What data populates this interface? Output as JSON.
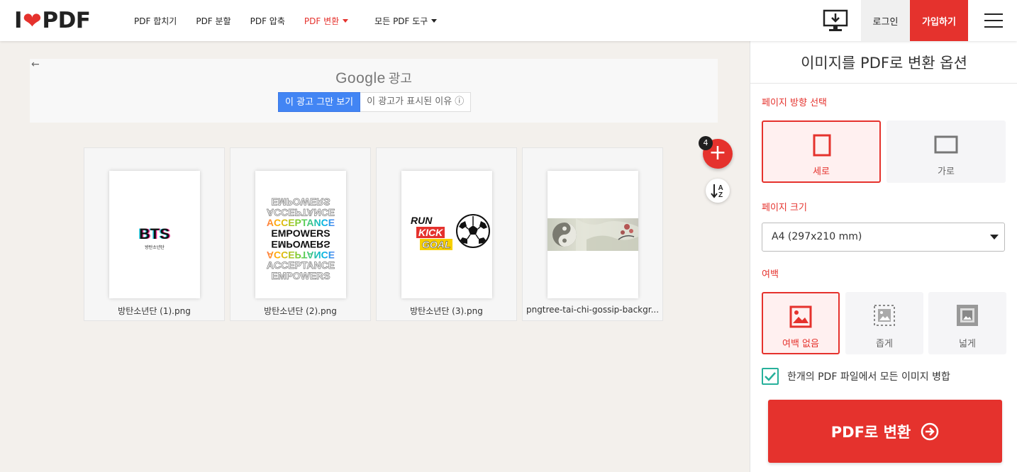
{
  "header": {
    "logo_left": "I",
    "logo_right": "PDF",
    "nav": [
      {
        "label": "PDF 합치기"
      },
      {
        "label": "PDF 분할"
      },
      {
        "label": "PDF 압축"
      },
      {
        "label": "PDF 변환"
      },
      {
        "label": "모든 PDF 도구"
      }
    ],
    "login": "로그인",
    "signup": "가입하기"
  },
  "ad": {
    "back": "←",
    "brand": "Google",
    "brand_suffix": "광고",
    "stop_label": "이 광고 그만 보기",
    "why_label": "이 광고가 표시된 이유 ⓘ"
  },
  "files": [
    {
      "name": "방탄소년단 (1).png",
      "thumb_title": "BTS",
      "thumb_sub": "방탄소년단"
    },
    {
      "name": "방탄소년단 (2).png",
      "thumb_lines": [
        "EMPOWERS",
        "ACCEPTANCE",
        "ACCEPTANCE",
        "EMPOWERS",
        "EMPOWERS",
        "ACCEPTANCE",
        "ACCEPTANCE",
        "EMPOWERS"
      ]
    },
    {
      "name": "방탄소년단 (3).png",
      "thumb_lines": [
        "RUN",
        "KICK",
        "GOAL"
      ]
    },
    {
      "name": "pngtree-tai-chi-gossip-backgr..."
    }
  ],
  "file_count": "4",
  "sort_label": "A Z",
  "panel": {
    "title": "이미지를 PDF로 변환 옵션",
    "orientation_label": "페이지 방향 선택",
    "orientation_options": [
      "세로",
      "가로"
    ],
    "orientation_selected": "세로",
    "size_label": "페이지 크기",
    "size_value": "A4 (297x210 mm)",
    "margin_label": "여백",
    "margin_options": [
      "여백 없음",
      "좁게",
      "넓게"
    ],
    "margin_selected": "여백 없음",
    "merge_label": "한개의 PDF 파일에서 모든 이미지 병합",
    "merge_checked": true,
    "convert_label": "PDF로 변환"
  },
  "colors": {
    "accent": "#e5322d",
    "check": "#27b09b",
    "ad_button": "#4285f4"
  }
}
